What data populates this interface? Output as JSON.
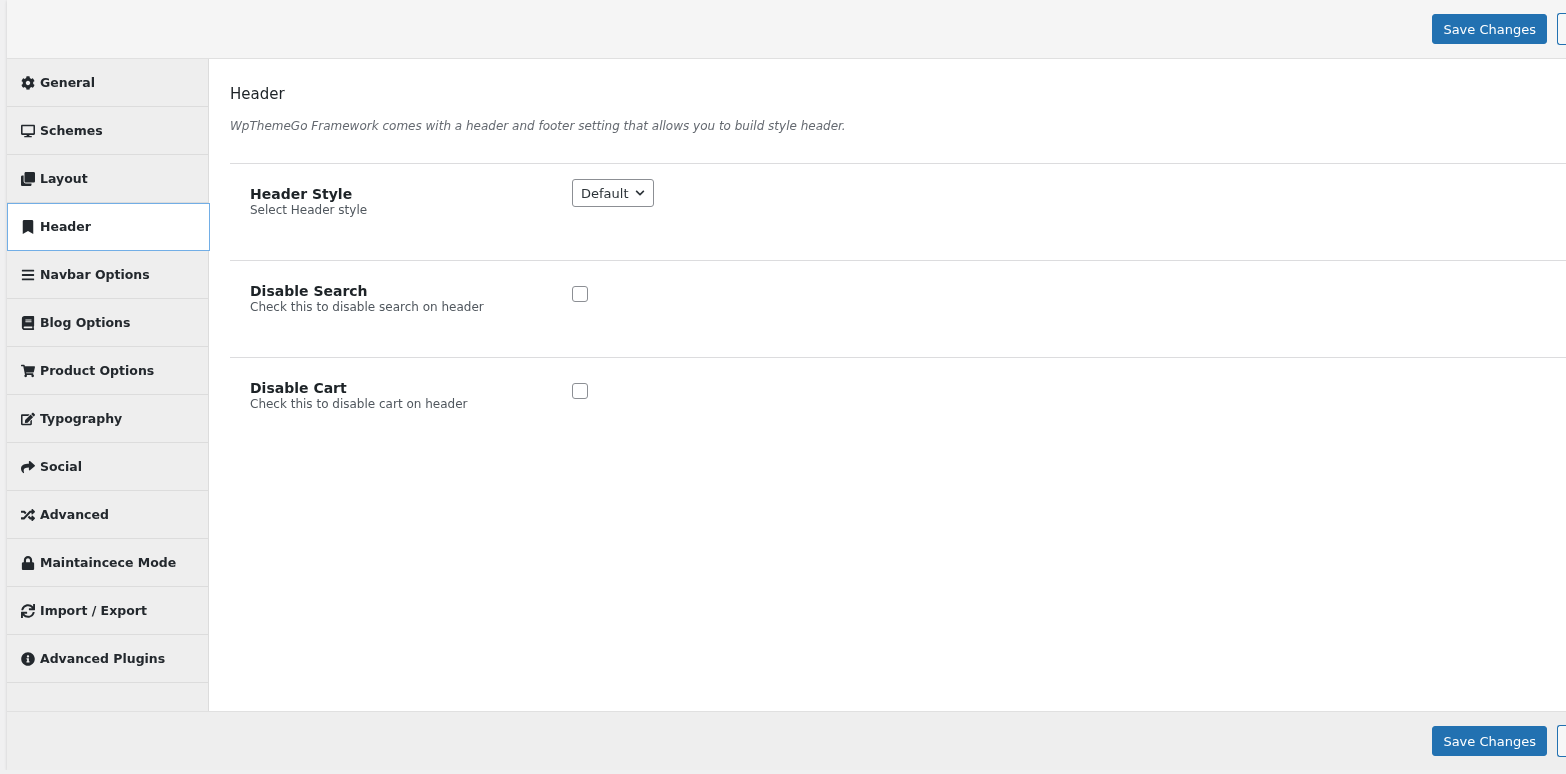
{
  "toolbar": {
    "save_button": "Save Changes"
  },
  "sidebar": {
    "items": [
      {
        "label": "General",
        "selected": false
      },
      {
        "label": "Schemes",
        "selected": false
      },
      {
        "label": "Layout",
        "selected": false
      },
      {
        "label": "Header",
        "selected": true
      },
      {
        "label": "Navbar Options",
        "selected": false
      },
      {
        "label": "Blog Options",
        "selected": false
      },
      {
        "label": "Product Options",
        "selected": false
      },
      {
        "label": "Typography",
        "selected": false
      },
      {
        "label": "Social",
        "selected": false
      },
      {
        "label": "Advanced",
        "selected": false
      },
      {
        "label": "Maintaincece Mode",
        "selected": false
      },
      {
        "label": "Import / Export",
        "selected": false
      },
      {
        "label": "Advanced Plugins",
        "selected": false
      }
    ]
  },
  "section": {
    "title": "Header",
    "description": "WpThemeGo Framework comes with a header and footer setting that allows you to build style header.",
    "fields": [
      {
        "kind": "select",
        "label": "Header Style",
        "hint": "Select Header style",
        "value": "Default"
      },
      {
        "kind": "checkbox",
        "label": "Disable Search",
        "hint": "Check this to disable search on header",
        "checked": false
      },
      {
        "kind": "checkbox",
        "label": "Disable Cart",
        "hint": "Check this to disable cart on header",
        "checked": false
      }
    ]
  },
  "footer": {
    "save_button": "Save Changes"
  }
}
